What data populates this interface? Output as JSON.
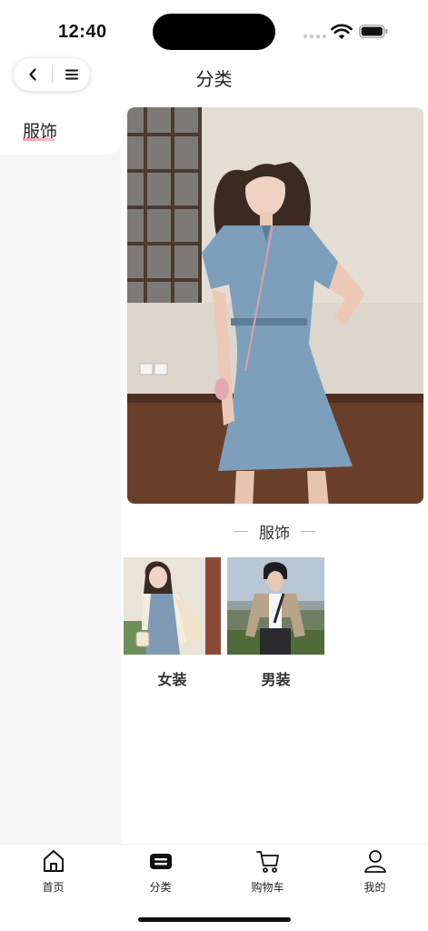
{
  "status_bar": {
    "time": "12:40"
  },
  "nav": {
    "title": "分类"
  },
  "sidebar": {
    "items": [
      {
        "label": "服饰",
        "selected": true
      }
    ]
  },
  "content": {
    "section_title": "服饰",
    "categories": [
      {
        "label": "女装"
      },
      {
        "label": "男装"
      }
    ]
  },
  "tabbar": {
    "items": [
      {
        "label": "首页",
        "icon": "home-icon"
      },
      {
        "label": "分类",
        "icon": "category-icon",
        "active": true
      },
      {
        "label": "购物车",
        "icon": "cart-icon"
      },
      {
        "label": "我的",
        "icon": "profile-icon"
      }
    ]
  },
  "colors": {
    "accent_underline": "#ff9db5",
    "sidebar_bg": "#f5f5f5"
  }
}
